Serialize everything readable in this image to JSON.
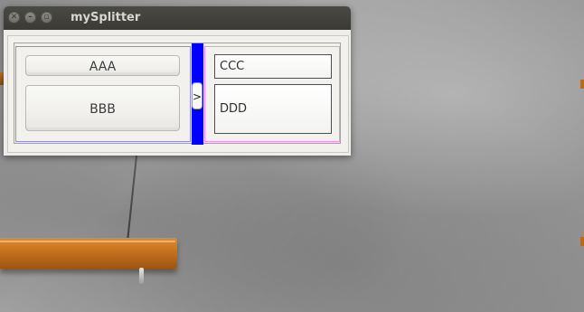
{
  "window": {
    "title": "mySplitter",
    "controls": {
      "close_icon": "close-icon",
      "minimize_icon": "minimize-icon",
      "maximize_icon": "maximize-icon"
    }
  },
  "left_pane": {
    "button_top": "AAA",
    "button_bottom": "BBB"
  },
  "splitter": {
    "handle_label": ">",
    "handle_color": "#0000ff"
  },
  "right_pane": {
    "field_top": "CCC",
    "field_bottom": "DDD"
  },
  "colors": {
    "left_border": "#8a8aff",
    "right_border": "#ff86ff",
    "titlebar": "#3b3a36"
  }
}
